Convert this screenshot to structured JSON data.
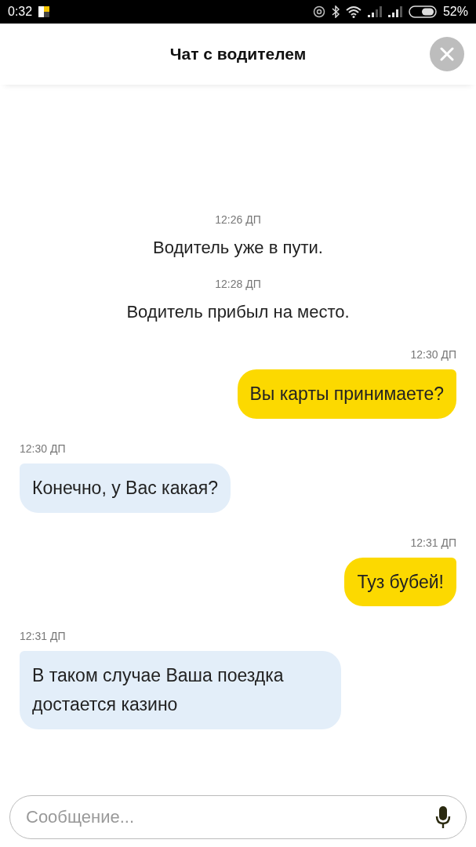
{
  "status_bar": {
    "time": "0:32",
    "battery": "52%"
  },
  "header": {
    "title": "Чат с водителем"
  },
  "messages": [
    {
      "kind": "system",
      "time": "12:26 ДП",
      "text": "Водитель уже в пути."
    },
    {
      "kind": "system",
      "time": "12:28 ДП",
      "text": "Водитель прибыл на место."
    },
    {
      "kind": "outgoing",
      "time": "12:30 ДП",
      "text": "Вы карты принимаете?"
    },
    {
      "kind": "incoming",
      "time": "12:30 ДП",
      "text": "Конечно, у Вас какая?"
    },
    {
      "kind": "outgoing",
      "time": "12:31 ДП",
      "text": "Туз бубей!"
    },
    {
      "kind": "incoming",
      "time": "12:31 ДП",
      "text": "В таком случае Ваша поездка достается казино"
    }
  ],
  "composer": {
    "placeholder": "Сообщение..."
  }
}
